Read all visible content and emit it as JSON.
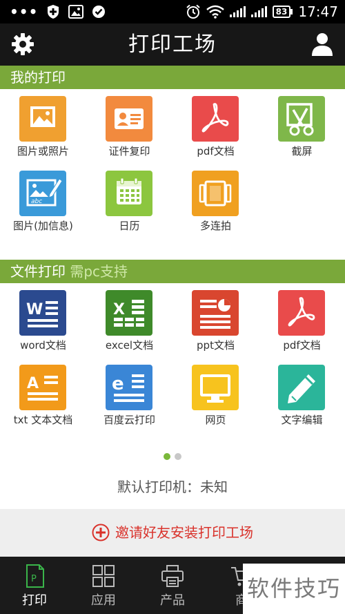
{
  "status_bar": {
    "dots": "•••",
    "time": "17:47",
    "battery": "83",
    "icons": [
      "shield-plus-icon",
      "image-icon",
      "check-circle-icon",
      "alarm-icon",
      "wifi-icon",
      "signal-icon",
      "signal-icon",
      "battery-icon"
    ]
  },
  "header": {
    "title": "打印工场",
    "left_icon": "gear-icon",
    "right_icon": "user-icon"
  },
  "my_print": {
    "title": "我的打印",
    "items": [
      {
        "label": "图片或照片",
        "icon": "photo-icon",
        "color": "#f0a030"
      },
      {
        "label": "证件复印",
        "icon": "id-card-icon",
        "color": "#f28a3e"
      },
      {
        "label": "pdf文档",
        "icon": "pdf-icon",
        "color": "#e94b4b"
      },
      {
        "label": "截屏",
        "icon": "screenshot-icon",
        "color": "#7fb74a"
      },
      {
        "label": "图片(加信息)",
        "icon": "photo-info-icon",
        "color": "#3a9ad9"
      },
      {
        "label": "日历",
        "icon": "calendar-icon",
        "color": "#8cc63f"
      },
      {
        "label": "多连拍",
        "icon": "multi-shot-icon",
        "color": "#f0a020"
      }
    ]
  },
  "file_print": {
    "title": "文件打印",
    "hint": "需pc支持",
    "items": [
      {
        "label": "word文档",
        "icon": "word-icon",
        "color": "#2b4a8f"
      },
      {
        "label": "excel文档",
        "icon": "excel-icon",
        "color": "#3f8a2a"
      },
      {
        "label": "ppt文档",
        "icon": "ppt-icon",
        "color": "#d9462f"
      },
      {
        "label": "pdf文档",
        "icon": "pdf-icon",
        "color": "#e94b4b"
      },
      {
        "label": "txt 文本文档",
        "icon": "txt-icon",
        "color": "#f29a1a"
      },
      {
        "label": "百度云打印",
        "icon": "baidu-cloud-icon",
        "color": "#3a86d6"
      },
      {
        "label": "网页",
        "icon": "webpage-icon",
        "color": "#f7c31e"
      },
      {
        "label": "文字编辑",
        "icon": "text-edit-icon",
        "color": "#2bb59a"
      }
    ]
  },
  "pager": {
    "active": 0,
    "count": 2
  },
  "printer": {
    "text": "默认打印机：未知"
  },
  "invite": {
    "label": "邀请好友安装打印工场",
    "icon": "plus-circle-icon",
    "color": "#d9322b"
  },
  "bottom_nav": [
    {
      "label": "打印",
      "icon": "print-doc-icon",
      "active": true
    },
    {
      "label": "应用",
      "icon": "apps-grid-icon",
      "active": false
    },
    {
      "label": "产品",
      "icon": "printer-icon",
      "active": false
    },
    {
      "label": "商",
      "icon": "cart-icon",
      "active": false
    }
  ],
  "watermark": "软件技巧",
  "colors": {
    "accent_green": "#7aa83a",
    "title_bar": "#171717",
    "active_tab": "#3ab54a"
  }
}
